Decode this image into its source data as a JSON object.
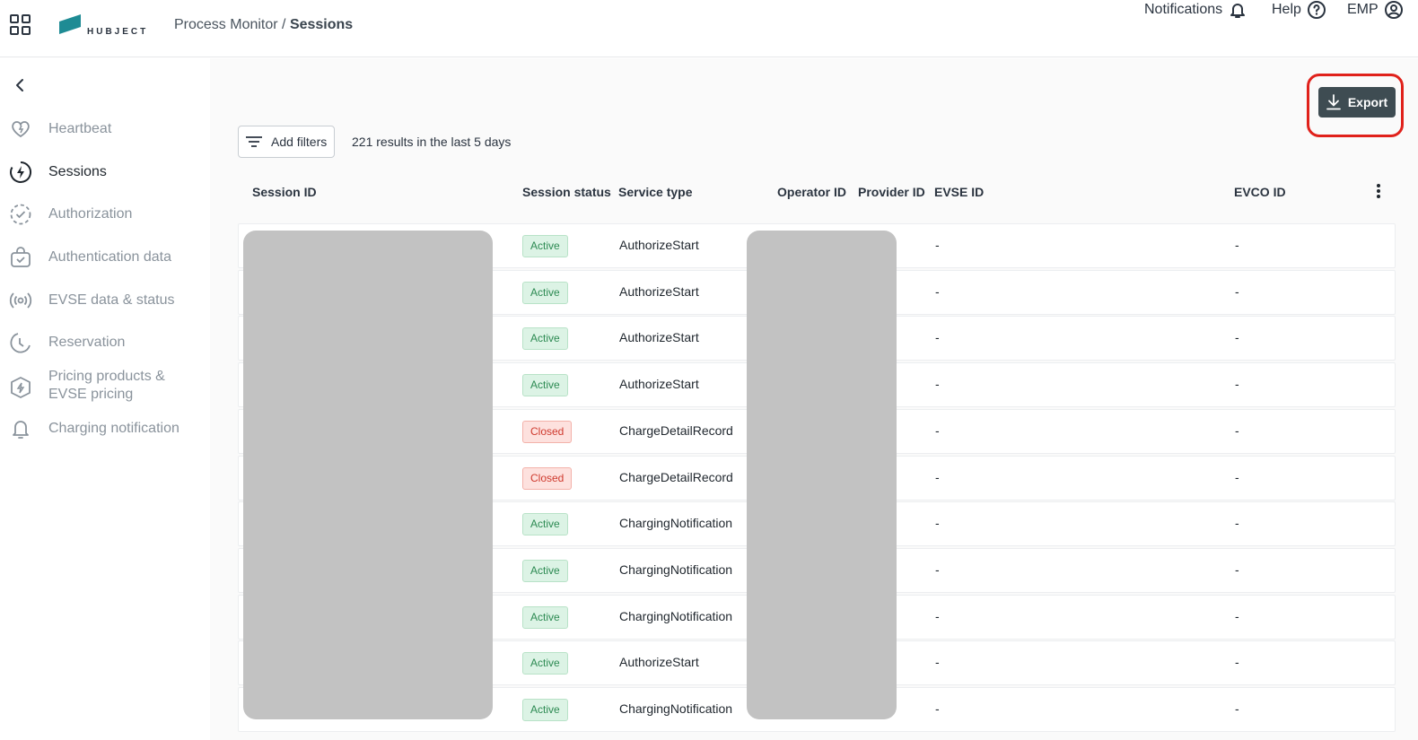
{
  "header": {
    "breadcrumb_parent": "Process Monitor /",
    "breadcrumb_current": "Sessions",
    "logo_text": "HUBJECT",
    "notifications_label": "Notifications",
    "help_label": "Help",
    "user_label": "EMP",
    "brand_color": "#1e8b94"
  },
  "sidebar": {
    "items": [
      {
        "label": "Heartbeat",
        "icon": "heart-icon",
        "active": false
      },
      {
        "label": "Sessions",
        "icon": "lightning-circle-icon",
        "active": true
      },
      {
        "label": "Authorization",
        "icon": "check-circle-dashed-icon",
        "active": false
      },
      {
        "label": "Authentication data",
        "icon": "bag-check-icon",
        "active": false
      },
      {
        "label": "EVSE data & status",
        "icon": "broadcast-icon",
        "active": false
      },
      {
        "label": "Reservation",
        "icon": "moon-clock-icon",
        "active": false
      },
      {
        "label": "Pricing products & EVSE pricing",
        "icon": "box-lightning-icon",
        "active": false
      },
      {
        "label": "Charging notification",
        "icon": "bell-icon",
        "active": false
      }
    ]
  },
  "toolbar": {
    "export_label": "Export",
    "add_filters_label": "Add filters",
    "results_text": "221 results in the last 5 days"
  },
  "table": {
    "columns": [
      "Session ID",
      "Session status",
      "Service type",
      "Operator ID",
      "Provider ID",
      "EVSE ID",
      "EVCO ID"
    ],
    "rows": [
      {
        "status": "Active",
        "service": "AuthorizeStart",
        "evse": "-",
        "evco": "-"
      },
      {
        "status": "Active",
        "service": "AuthorizeStart",
        "evse": "-",
        "evco": "-"
      },
      {
        "status": "Active",
        "service": "AuthorizeStart",
        "evse": "-",
        "evco": "-"
      },
      {
        "status": "Active",
        "service": "AuthorizeStart",
        "evse": "-",
        "evco": "-"
      },
      {
        "status": "Closed",
        "service": "ChargeDetailRecord",
        "evse": "-",
        "evco": "-"
      },
      {
        "status": "Closed",
        "service": "ChargeDetailRecord",
        "evse": "-",
        "evco": "-"
      },
      {
        "status": "Active",
        "service": "ChargingNotification",
        "evse": "-",
        "evco": "-"
      },
      {
        "status": "Active",
        "service": "ChargingNotification",
        "evse": "-",
        "evco": "-"
      },
      {
        "status": "Active",
        "service": "ChargingNotification",
        "evse": "-",
        "evco": "-"
      },
      {
        "status": "Active",
        "service": "AuthorizeStart",
        "evse": "-",
        "evco": "-"
      },
      {
        "status": "Active",
        "service": "ChargingNotification",
        "evse": "-",
        "evco": "-"
      }
    ]
  }
}
